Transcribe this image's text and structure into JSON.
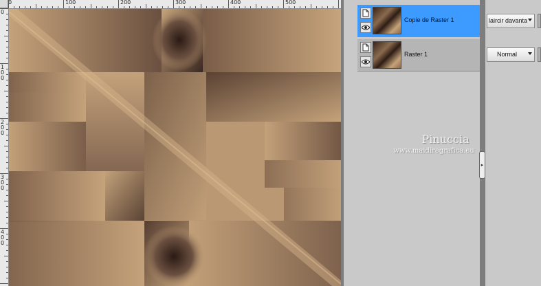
{
  "ruler": {
    "top_labels": [
      "0",
      "100",
      "200",
      "300",
      "400",
      "500"
    ],
    "left_labels": [
      "0",
      "1\n0\n0",
      "2\n0\n0",
      "3\n0\n0",
      "4\n0\n0"
    ]
  },
  "layers": [
    {
      "name": "Copie de Raster 1",
      "selected": true,
      "blend_mode": "Éclaircir davantage",
      "blend_display": "laircir davanta­"
    },
    {
      "name": "Raster 1",
      "selected": false,
      "blend_mode": "Normal",
      "blend_display": "Normal"
    }
  ],
  "watermark": {
    "name": "Pinuccia",
    "url": "www.maidiregrafica.eu"
  },
  "colors": {
    "selection": "#3d9bff",
    "panel_bg": "#c9c9c9",
    "canvas_light": "#c9a77f",
    "canvas_dark": "#2e1d14"
  },
  "icons": {
    "visibility": "eye-icon",
    "layer_type": "raster-page-icon",
    "panel_toggle": "chevron-right-icon"
  }
}
